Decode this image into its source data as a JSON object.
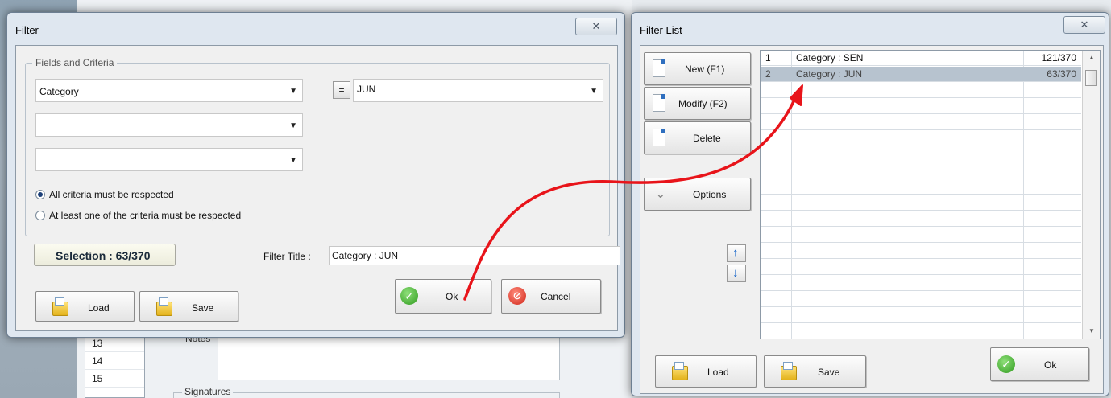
{
  "background": {
    "row_numbers": [
      "13",
      "14",
      "15"
    ],
    "notes_label": "Notes",
    "signatures_label": "Signatures"
  },
  "filter_dialog": {
    "title": "Filter",
    "close_glyph": "✕",
    "fields_group_label": "Fields and Criteria",
    "field1_value": "Category",
    "field2_value": "",
    "field3_value": "",
    "operator": "=",
    "criteria_value": "JUN",
    "radio_all": "All criteria must be respected",
    "radio_any": "At least one of the criteria must be respected",
    "selection_label": "Selection : 63/370",
    "filter_title_label": "Filter Title :",
    "filter_title_value": "Category : JUN",
    "ok_label": "Ok",
    "cancel_label": "Cancel",
    "load_label": "Load",
    "save_label": "Save"
  },
  "filter_list_dialog": {
    "title": "Filter List",
    "close_glyph": "✕",
    "new_label": "New (F1)",
    "modify_label": "Modify (F2)",
    "delete_label": "Delete",
    "options_label": "Options",
    "load_label": "Load",
    "save_label": "Save",
    "ok_label": "Ok",
    "rows": [
      {
        "num": "1",
        "name": "Category : SEN",
        "count": "121/370"
      },
      {
        "num": "2",
        "name": "Category : JUN",
        "count": "63/370"
      }
    ]
  },
  "colors": {
    "arrow": "#e8141a",
    "dialog_bg": "#dfe7f0"
  }
}
